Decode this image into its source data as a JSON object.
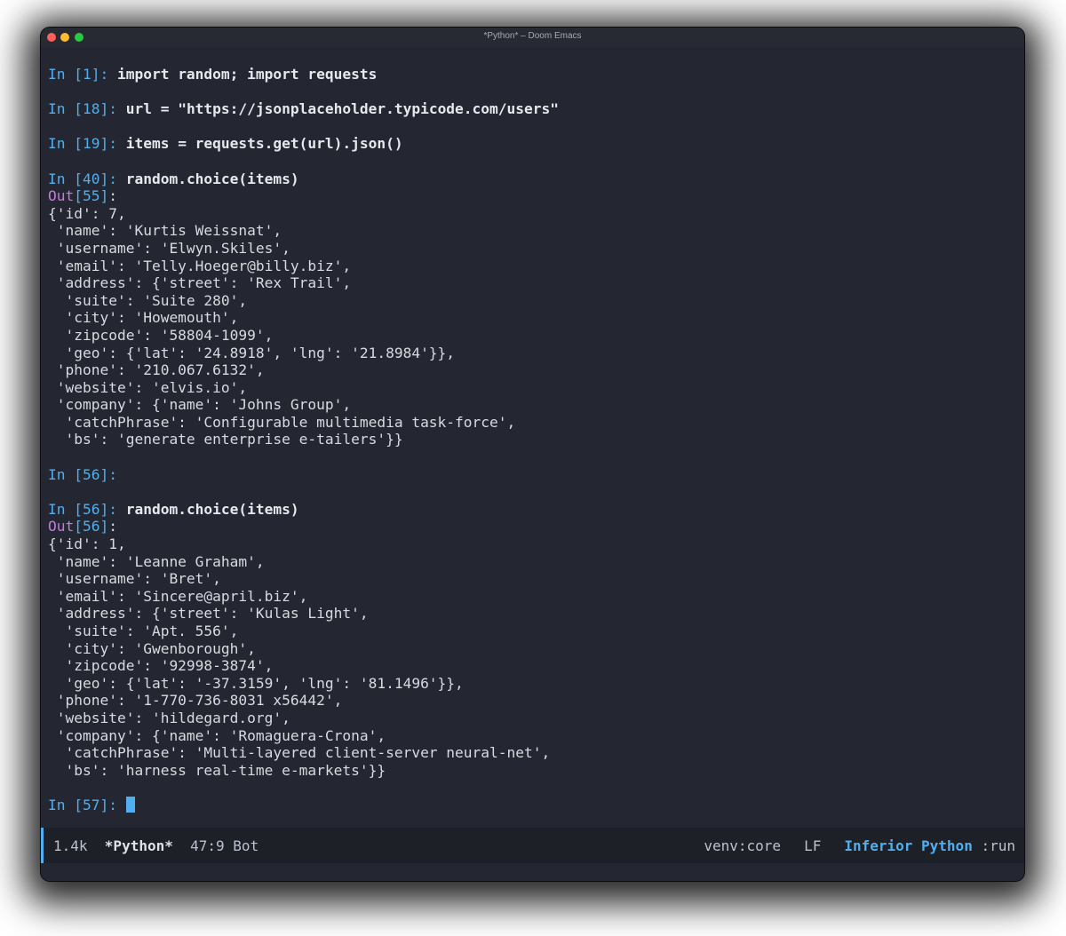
{
  "window": {
    "title": "*Python* – Doom Emacs"
  },
  "repl": [
    {
      "kind": "in",
      "prompt": "In [1]: ",
      "code": "import random; import requests"
    },
    {
      "kind": "blank"
    },
    {
      "kind": "in",
      "prompt": "In [18]: ",
      "code": "url = \"https://jsonplaceholder.typicode.com/users\""
    },
    {
      "kind": "blank"
    },
    {
      "kind": "in",
      "prompt": "In [19]: ",
      "code": "items = requests.get(url).json()"
    },
    {
      "kind": "blank"
    },
    {
      "kind": "in",
      "prompt": "In [40]: ",
      "code": "random.choice(items)"
    },
    {
      "kind": "out",
      "label": "Out",
      "num": "[55]",
      "suffix": ":"
    },
    {
      "kind": "text",
      "text": "{'id': 7,"
    },
    {
      "kind": "text",
      "text": " 'name': 'Kurtis Weissnat',"
    },
    {
      "kind": "text",
      "text": " 'username': 'Elwyn.Skiles',"
    },
    {
      "kind": "text",
      "text": " 'email': 'Telly.Hoeger@billy.biz',"
    },
    {
      "kind": "text",
      "text": " 'address': {'street': 'Rex Trail',"
    },
    {
      "kind": "text",
      "text": "  'suite': 'Suite 280',"
    },
    {
      "kind": "text",
      "text": "  'city': 'Howemouth',"
    },
    {
      "kind": "text",
      "text": "  'zipcode': '58804-1099',"
    },
    {
      "kind": "text",
      "text": "  'geo': {'lat': '24.8918', 'lng': '21.8984'}},"
    },
    {
      "kind": "text",
      "text": " 'phone': '210.067.6132',"
    },
    {
      "kind": "text",
      "text": " 'website': 'elvis.io',"
    },
    {
      "kind": "text",
      "text": " 'company': {'name': 'Johns Group',"
    },
    {
      "kind": "text",
      "text": "  'catchPhrase': 'Configurable multimedia task-force',"
    },
    {
      "kind": "text",
      "text": "  'bs': 'generate enterprise e-tailers'}}"
    },
    {
      "kind": "blank"
    },
    {
      "kind": "in",
      "prompt": "In [56]: ",
      "code": ""
    },
    {
      "kind": "blank"
    },
    {
      "kind": "in",
      "prompt": "In [56]: ",
      "code": "random.choice(items)"
    },
    {
      "kind": "out",
      "label": "Out",
      "num": "[56]",
      "suffix": ":"
    },
    {
      "kind": "text",
      "text": "{'id': 1,"
    },
    {
      "kind": "text",
      "text": " 'name': 'Leanne Graham',"
    },
    {
      "kind": "text",
      "text": " 'username': 'Bret',"
    },
    {
      "kind": "text",
      "text": " 'email': 'Sincere@april.biz',"
    },
    {
      "kind": "text",
      "text": " 'address': {'street': 'Kulas Light',"
    },
    {
      "kind": "text",
      "text": "  'suite': 'Apt. 556',"
    },
    {
      "kind": "text",
      "text": "  'city': 'Gwenborough',"
    },
    {
      "kind": "text",
      "text": "  'zipcode': '92998-3874',"
    },
    {
      "kind": "text",
      "text": "  'geo': {'lat': '-37.3159', 'lng': '81.1496'}},"
    },
    {
      "kind": "text",
      "text": " 'phone': '1-770-736-8031 x56442',"
    },
    {
      "kind": "text",
      "text": " 'website': 'hildegard.org',"
    },
    {
      "kind": "text",
      "text": " 'company': {'name': 'Romaguera-Crona',"
    },
    {
      "kind": "text",
      "text": "  'catchPhrase': 'Multi-layered client-server neural-net',"
    },
    {
      "kind": "text",
      "text": "  'bs': 'harness real-time e-markets'}}"
    },
    {
      "kind": "blank"
    },
    {
      "kind": "in",
      "prompt": "In [57]: ",
      "code": "",
      "cursor": true
    }
  ],
  "modeline": {
    "size": "1.4k",
    "buffer": "*Python*",
    "position": "47:9",
    "scroll": "Bot",
    "env": "venv:core",
    "eol": "LF",
    "major_mode": "Inferior Python",
    "process": ":run"
  },
  "colors": {
    "background": "#242731",
    "prompt": "#51afef",
    "out_label": "#c678dd",
    "text": "#d8dae0"
  }
}
